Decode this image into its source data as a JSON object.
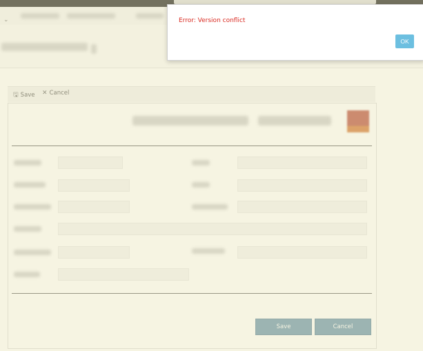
{
  "toolbar": {
    "save_label": "Save",
    "cancel_label": "Cancel",
    "save_icon": "floppy-disk-icon",
    "cancel_icon": "x-icon"
  },
  "form": {
    "save_label": "Save",
    "cancel_label": "Cancel"
  },
  "dialog": {
    "message": "Error: Version conflict",
    "ok_label": "OK"
  },
  "colors": {
    "error_text": "#d9281f",
    "ok_button": "#6cbfe0",
    "form_button": "#5b8aa8",
    "overlay": "#ebe7be"
  }
}
